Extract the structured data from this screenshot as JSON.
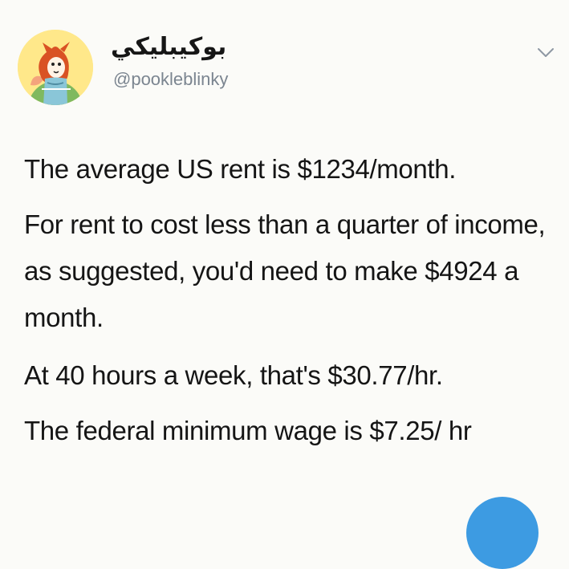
{
  "tweet": {
    "author": {
      "display_name": "بوكيبليكي",
      "handle": "@pookleblinky",
      "avatar_icon": "cartoon-girl-avatar-icon"
    },
    "menu_icon": "chevron-down-icon",
    "paragraphs": [
      "The average US rent is $1234/month.",
      "For rent to cost less than a quarter of income, as suggested, you'd need to make $4924 a month.",
      "At 40 hours a week, that's $30.77/hr.",
      "The federal minimum wage is $7.25/ hr"
    ]
  },
  "colors": {
    "background": "#fbfbf8",
    "text": "#151515",
    "secondary_text": "#7b8590",
    "accent": "#3d9be2",
    "avatar_bg": "#ffe88a"
  }
}
